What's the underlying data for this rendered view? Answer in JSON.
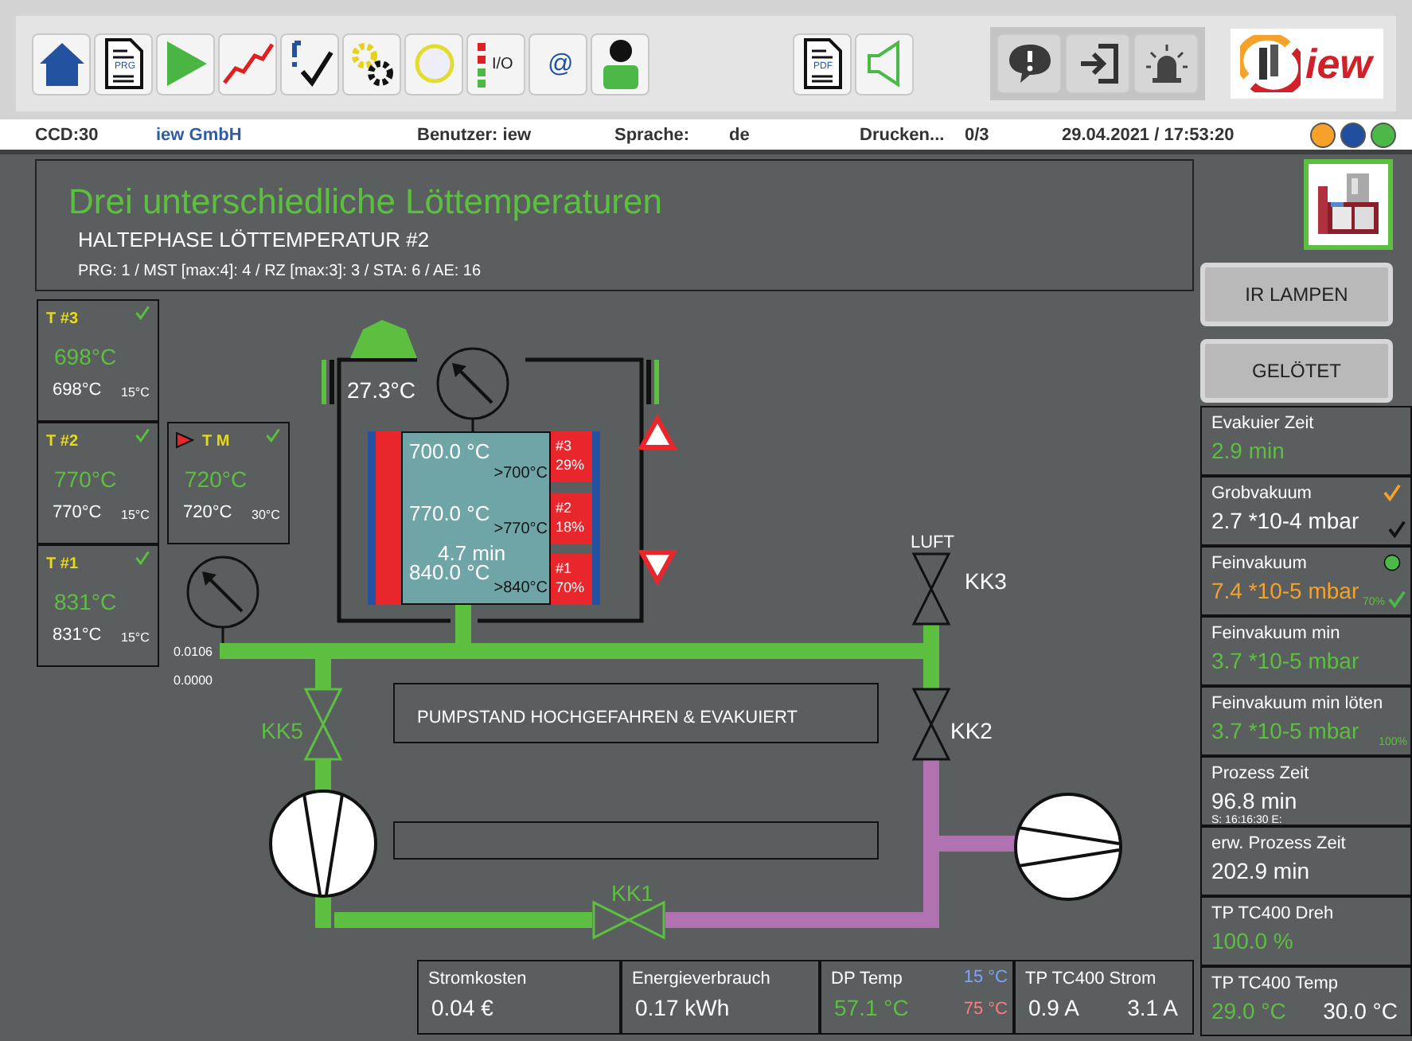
{
  "toolbar": {
    "groups": [
      {
        "kind": "main",
        "buttons": [
          {
            "kind": "home"
          },
          {
            "kind": "document",
            "label": "PRG"
          },
          {
            "kind": "play"
          },
          {
            "kind": "chart"
          },
          {
            "kind": "checklist"
          },
          {
            "kind": "gears"
          },
          {
            "kind": "circle"
          },
          {
            "kind": "io",
            "label": "I/O"
          },
          {
            "kind": "text",
            "label": "@"
          },
          {
            "kind": "person"
          }
        ]
      },
      {
        "kind": "main",
        "buttons": [
          {
            "kind": "document",
            "label": "PDF"
          },
          {
            "kind": "speaker"
          }
        ]
      },
      {
        "kind": "panel",
        "buttons": [
          {
            "kind": "alert"
          },
          {
            "kind": "login"
          },
          {
            "kind": "siren"
          }
        ]
      }
    ],
    "logo": {
      "text": "iew"
    }
  },
  "status_bar": {
    "items": [
      {
        "text": "CCD:30",
        "kind": "plain"
      },
      {
        "text": "iew GmbH",
        "kind": "link"
      },
      {
        "text": "Benutzer: iew",
        "kind": "plain"
      },
      {
        "text": "Sprache:",
        "kind": "plain"
      },
      {
        "text": "de",
        "kind": "plain"
      },
      {
        "text": "Drucken...",
        "kind": "plain"
      },
      {
        "text": "0/3",
        "kind": "plain"
      },
      {
        "text": "29.04.2021 / 17:53:20",
        "kind": "plain"
      }
    ],
    "lights": [
      {
        "color": "#f5a12a"
      },
      {
        "color": "#1f4f9e"
      },
      {
        "color": "#4cb848"
      }
    ]
  },
  "header": {
    "title": "Drei unterschiedliche Löttemperaturen",
    "phase": "HALTEPHASE LÖTTEMPERATUR #2",
    "info": "PRG: 1 / MST [max:4]: 4 / RZ [max:3]: 3 / STA: 6 / AE: 16"
  },
  "sensors": [
    {
      "label": "T #3",
      "value": "698°C",
      "actual": "698°C",
      "ambient": "15°C",
      "checked": true,
      "active": false
    },
    {
      "label": "T #2",
      "value": "770°C",
      "actual": "770°C",
      "ambient": "15°C",
      "checked": true,
      "active": false
    },
    {
      "label": "T #1",
      "value": "831°C",
      "actual": "831°C",
      "ambient": "15°C",
      "checked": true,
      "active": false
    },
    {
      "label": "T M",
      "value": "720°C",
      "actual": "720°C",
      "ambient": "30°C",
      "checked": true,
      "active": true
    }
  ],
  "chamber": {
    "temperature": "27.3°C",
    "time": "4.7 min",
    "zones": [
      {
        "temp": "700.0 °C",
        "target": ">700°C",
        "id": "#3",
        "power": "29%"
      },
      {
        "temp": "770.0 °C",
        "target": ">770°C",
        "id": "#2",
        "power": "18%"
      },
      {
        "temp": "840.0 °C",
        "target": ">840°C",
        "id": "#1",
        "power": "70%"
      }
    ]
  },
  "gauge": {
    "readings": [
      "0.0106",
      "0.0000"
    ]
  },
  "valves": [
    {
      "label": "KK3",
      "open": false
    },
    {
      "label": "KK2",
      "open": false
    },
    {
      "label": "KK5",
      "open": true
    },
    {
      "label": "KK1",
      "open": true
    }
  ],
  "air_label": "LUFT",
  "messages": [
    "PUMPSTAND HOCHGEFAHREN & EVAKUIERT"
  ],
  "bottom_cells": [
    {
      "label": "Stromkosten",
      "values": [
        {
          "text": "0.04 €",
          "color": "#ffffff"
        }
      ]
    },
    {
      "label": "Energieverbrauch",
      "values": [
        {
          "text": "0.17 kWh",
          "color": "#ffffff"
        }
      ]
    },
    {
      "label": "DP Temp",
      "values": [
        {
          "text": "57.1 °C",
          "color": "#5cbf3f"
        }
      ],
      "limits": [
        {
          "text": "15 °C",
          "color": "#7aa2ff"
        },
        {
          "text": "75 °C",
          "color": "#ff7a86"
        }
      ]
    },
    {
      "label": "TP TC400 Strom",
      "values": [
        {
          "text": "0.9 A",
          "color": "#ffffff"
        },
        {
          "text": "3.1 A",
          "color": "#ffffff"
        }
      ]
    }
  ],
  "side": {
    "machine_view": {
      "kind": "picture"
    },
    "buttons": [
      "IR LAMPEN",
      "GELÖTET"
    ],
    "cells": [
      {
        "label": "Evakuier Zeit",
        "values": [
          {
            "text": "2.9 min",
            "color": "#5cbf3f"
          }
        ]
      },
      {
        "label": "Grobvakuum",
        "values": [
          {
            "text": "2.7 *10-4 mbar",
            "color": "#ffffff"
          }
        ],
        "marks": [
          {
            "kind": "check",
            "color": "#f5a12a"
          },
          {
            "kind": "check",
            "color": "#111111"
          }
        ]
      },
      {
        "label": "Feinvakuum",
        "values": [
          {
            "text": "7.4 *10-5 mbar",
            "color": "#f5a12a"
          }
        ],
        "badge": "70%",
        "marks": [
          {
            "kind": "dot",
            "color": "#4cb848"
          },
          {
            "kind": "check",
            "color": "#4cb848"
          }
        ]
      },
      {
        "label": "Feinvakuum min",
        "values": [
          {
            "text": "3.7 *10-5 mbar",
            "color": "#5cbf3f"
          }
        ]
      },
      {
        "label": "Feinvakuum min löten",
        "values": [
          {
            "text": "3.7 *10-5 mbar",
            "color": "#5cbf3f"
          }
        ],
        "badge": "100%"
      },
      {
        "label": "Prozess Zeit",
        "values": [
          {
            "text": "96.8 min",
            "color": "#ffffff"
          }
        ],
        "note": "S: 16:16:30 E:"
      },
      {
        "label": "erw. Prozess Zeit",
        "values": [
          {
            "text": "202.9 min",
            "color": "#ffffff"
          }
        ]
      },
      {
        "label": "TP TC400 Dreh",
        "values": [
          {
            "text": "100.0 %",
            "color": "#5cbf3f"
          }
        ]
      },
      {
        "label": "TP TC400 Temp",
        "values": [
          {
            "text": "29.0 °C",
            "color": "#5cbf3f"
          },
          {
            "text": "30.0 °C",
            "color": "#ffffff"
          }
        ]
      }
    ]
  }
}
